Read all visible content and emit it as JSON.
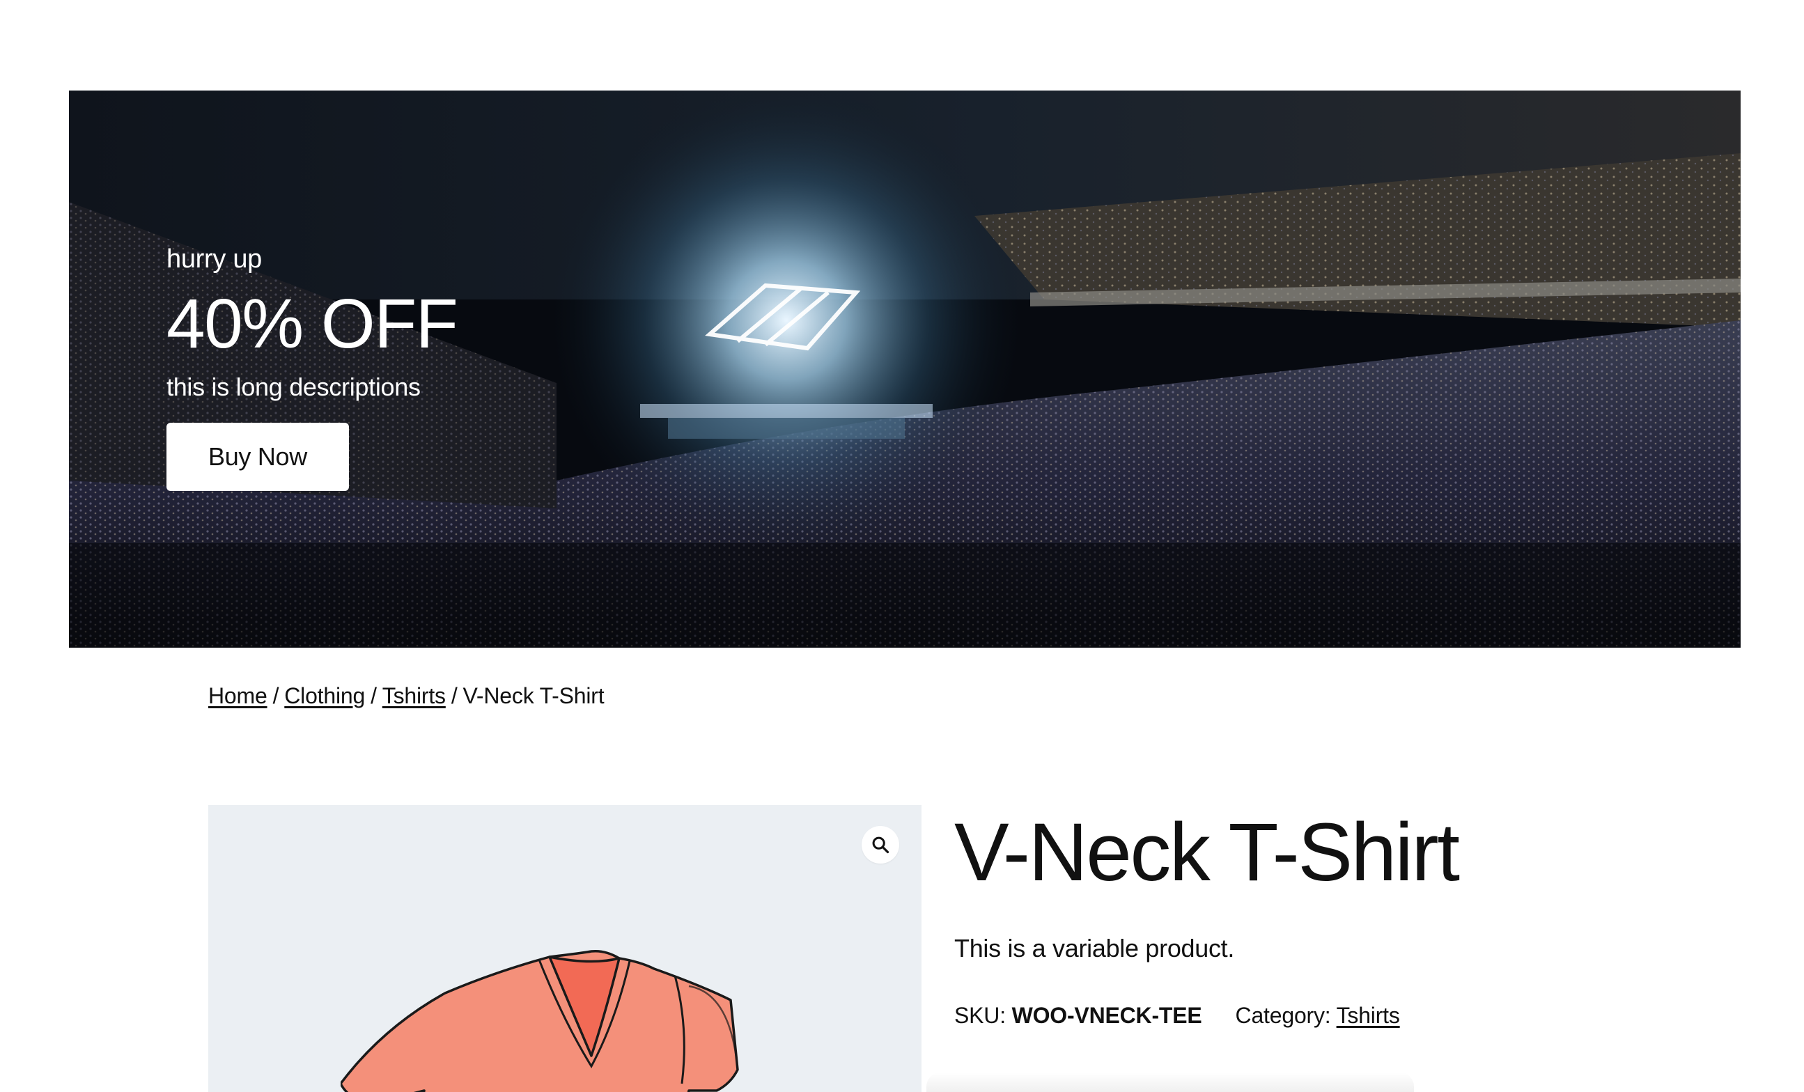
{
  "hero": {
    "eyebrow": "hurry up",
    "headline": "40% OFF",
    "description": "this is long descriptions",
    "button_label": "Buy Now"
  },
  "breadcrumb": {
    "items": [
      {
        "label": "Home",
        "link": true
      },
      {
        "label": "Clothing",
        "link": true
      },
      {
        "label": "Tshirts",
        "link": true
      },
      {
        "label": "V-Neck T-Shirt",
        "link": false
      }
    ],
    "separator": "/"
  },
  "gallery": {
    "zoom_icon": "magnifier-icon",
    "product_image": "v-neck-tshirt-illustration",
    "shirt_color": "#f4907a",
    "background_color": "#ebeff3"
  },
  "product": {
    "title": "V-Neck T-Shirt",
    "short_description": "This is a variable product.",
    "sku_label": "SKU:",
    "sku_value": "WOO-VNECK-TEE",
    "category_label": "Category:",
    "category_value": "Tshirts"
  }
}
